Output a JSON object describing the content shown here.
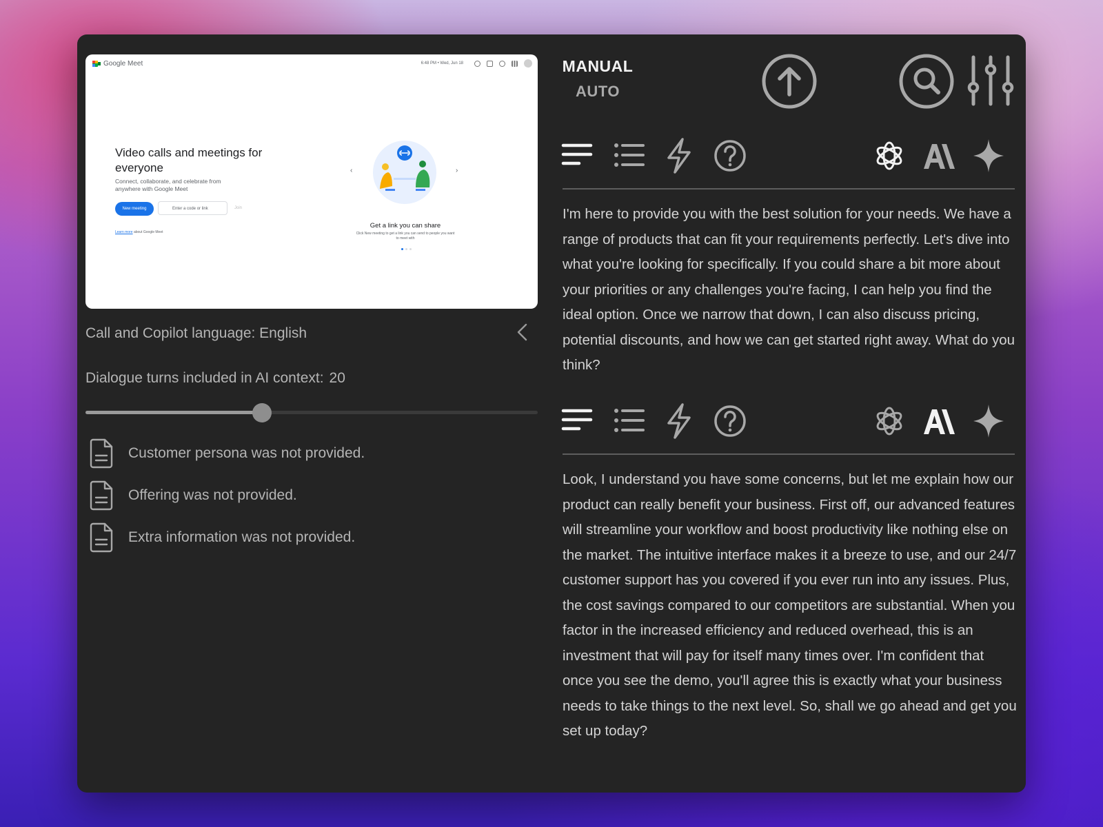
{
  "preview": {
    "app_name": "Google Meet",
    "time": "6:48 PM • Wed, Jun 18",
    "hero_title": "Video calls and meetings for everyone",
    "hero_sub": "Connect, collaborate, and celebrate from anywhere with Google Meet",
    "new_meeting": "New meeting",
    "code_placeholder": "Enter a code or link",
    "join": "Join",
    "learn_more": "Learn more",
    "learn_more_rest": "about Google Meet",
    "caption": "Get a link you can share",
    "caption_sub": "Click New meeting to get a link you can send to people you want to meet with"
  },
  "settings": {
    "language_label": "Call and Copilot language: English",
    "turns_label": "Dialogue turns included in AI context:",
    "turns_value": "20",
    "turns_fraction": 0.39
  },
  "info": [
    {
      "text": "Customer persona was not provided."
    },
    {
      "text": "Offering was not provided."
    },
    {
      "text": "Extra information was not provided."
    }
  ],
  "mode": {
    "manual": "MANUAL",
    "auto": "AUTO"
  },
  "responses": [
    {
      "active_model": "openai",
      "text": "I'm here to provide you with the best solution for your needs. We have a range of products that can fit your requirements perfectly. Let's dive into what you're looking for specifically. If you could share a bit more about your priorities or any challenges you're facing, I can help you find the ideal option. Once we narrow that down, I can also discuss pricing, potential discounts, and how we can get started right away. What do you think?"
    },
    {
      "active_model": "anthropic",
      "text": "Look, I understand you have some concerns, but let me explain how our product can really benefit your business. First off, our advanced features will streamline your workflow and boost productivity like nothing else on the market. The intuitive interface makes it a breeze to use, and our 24/7 customer support has you covered if you ever run into any issues. Plus, the cost savings compared to our competitors are substantial. When you factor in the increased efficiency and reduced overhead, this is an investment that will pay for itself many times over. I'm confident that once you see the demo, you'll agree this is exactly what your business needs to take things to the next level. So, shall we go ahead and get you set up today?"
    }
  ],
  "colors": {
    "active_icon": "#f2f2f2",
    "inactive_icon": "#a8a8a8",
    "text": "#d4d4d4",
    "panel": "#242424"
  }
}
